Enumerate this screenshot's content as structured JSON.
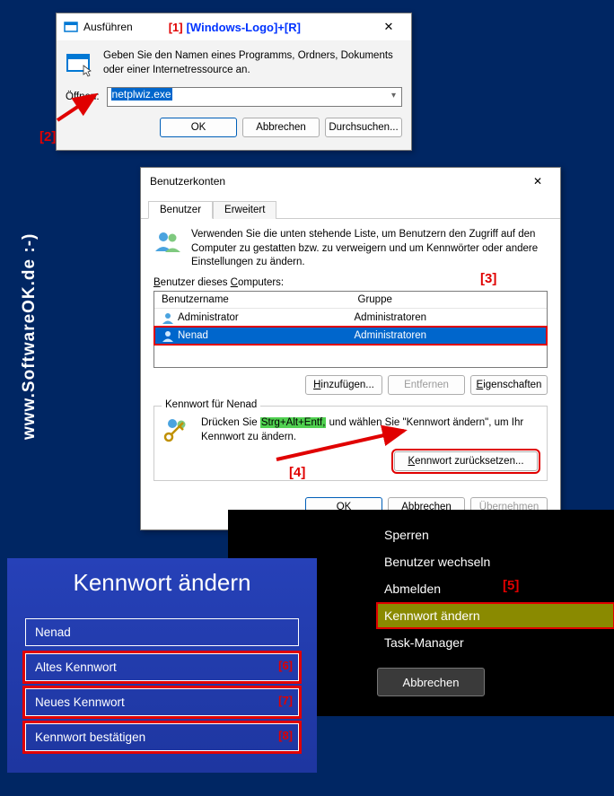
{
  "watermark": "www.SoftwareOK.de :-)",
  "annotations": {
    "a1": "[1]",
    "a1_text": "[Windows-Logo]+[R]",
    "a2": "[2]",
    "a3": "[3]",
    "a4": "[4]",
    "a5": "[5]",
    "a6": "[6]",
    "a7": "[7]",
    "a8": "[8]"
  },
  "run": {
    "title": "Ausführen",
    "description": "Geben Sie den Namen eines Programms, Ordners, Dokuments oder einer Internetressource an.",
    "open_label": "Öffnen:",
    "value": "netplwiz.exe",
    "ok": "OK",
    "cancel": "Abbrechen",
    "browse": "Durchsuchen...",
    "close": "✕"
  },
  "ua": {
    "title": "Benutzerkonten",
    "tab1": "Benutzer",
    "tab2": "Erweitert",
    "desc": "Verwenden Sie die unten stehende Liste, um Benutzern den Zugriff auf den Computer zu gestatten bzw. zu verweigern und um Kennwörter oder andere Einstellungen zu ändern.",
    "list_label": "Benutzer dieses Computers:",
    "col1": "Benutzername",
    "col2": "Gruppe",
    "rows": [
      {
        "name": "Administrator",
        "group": "Administratoren"
      },
      {
        "name": "Nenad",
        "group": "Administratoren"
      }
    ],
    "add": "Hinzufügen...",
    "remove": "Entfernen",
    "props": "Eigenschaften",
    "pw_legend": "Kennwort für Nenad",
    "pw_text_a": "Drücken Sie ",
    "pw_text_hl": "Strg+Alt+Entf,",
    "pw_text_b": " und wählen Sie \"Kennwort ändern\", um Ihr Kennwort zu ändern.",
    "reset": "Kennwort zurücksetzen...",
    "ok": "OK",
    "cancel": "Abbrechen",
    "apply": "Übernehmen",
    "close": "✕"
  },
  "cad": {
    "items": [
      "Sperren",
      "Benutzer wechseln",
      "Abmelden",
      "Kennwort ändern",
      "Task-Manager"
    ],
    "cancel": "Abbrechen"
  },
  "cp": {
    "title": "Kennwort ändern",
    "user": "Nenad",
    "old": "Altes Kennwort",
    "new": "Neues Kennwort",
    "confirm": "Kennwort bestätigen"
  }
}
